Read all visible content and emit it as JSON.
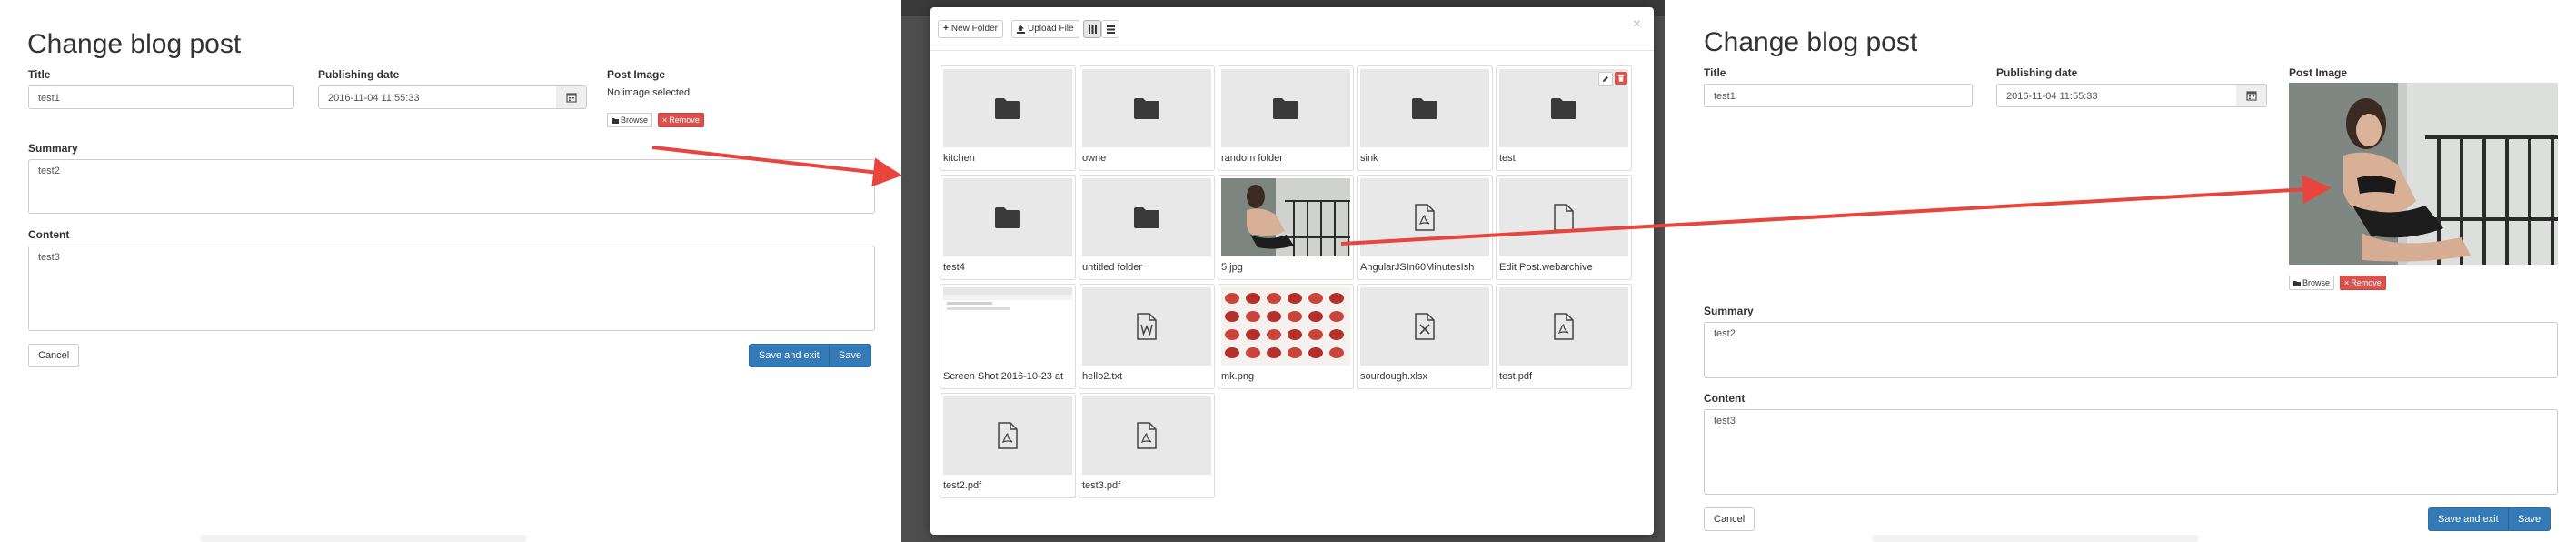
{
  "left": {
    "title": "Change blog post",
    "title_label": "Title",
    "title_value": "test1",
    "date_label": "Publishing date",
    "date_value": "2016-11-04 11:55:33",
    "image_label": "Post Image",
    "no_image_text": "No image selected",
    "browse_label": "Browse",
    "remove_label": "Remove",
    "summary_label": "Summary",
    "summary_value": "test2",
    "content_label": "Content",
    "content_value": "test3",
    "cancel_label": "Cancel",
    "save_exit_label": "Save and exit",
    "save_label": "Save"
  },
  "modal": {
    "new_folder_label": "New Folder",
    "upload_file_label": "Upload File",
    "close_symbol": "×",
    "items": [
      {
        "name": "kitchen",
        "kind": "folder"
      },
      {
        "name": "owne",
        "kind": "folder"
      },
      {
        "name": "random folder",
        "kind": "folder"
      },
      {
        "name": "sink",
        "kind": "folder"
      },
      {
        "name": "test",
        "kind": "folder"
      },
      {
        "name": "test4",
        "kind": "folder"
      },
      {
        "name": "untitled folder",
        "kind": "folder"
      },
      {
        "name": "5.jpg",
        "kind": "photo"
      },
      {
        "name": "AngularJSIn60MinutesIsh",
        "kind": "pdf"
      },
      {
        "name": "Edit Post.webarchive",
        "kind": "file"
      },
      {
        "name": "Screen Shot 2016-10-23 at",
        "kind": "screenshot"
      },
      {
        "name": "hello2.txt",
        "kind": "word"
      },
      {
        "name": "mk.png",
        "kind": "meat"
      },
      {
        "name": "sourdough.xlsx",
        "kind": "excel"
      },
      {
        "name": "test.pdf",
        "kind": "pdf"
      },
      {
        "name": "test2.pdf",
        "kind": "pdf"
      },
      {
        "name": "test3.pdf",
        "kind": "pdf"
      }
    ]
  },
  "right": {
    "title": "Change blog post",
    "title_label": "Title",
    "title_value": "test1",
    "date_label": "Publishing date",
    "date_value": "2016-11-04 11:55:33",
    "image_label": "Post Image",
    "browse_label": "Browse",
    "remove_label": "Remove",
    "summary_label": "Summary",
    "summary_value": "test2",
    "content_label": "Content",
    "content_value": "test3",
    "cancel_label": "Cancel",
    "save_exit_label": "Save and exit",
    "save_label": "Save"
  },
  "colors": {
    "primary": "#337ab7",
    "danger": "#d9534f",
    "arrow": "#e8453c",
    "overlay": "#4d4d4d"
  }
}
